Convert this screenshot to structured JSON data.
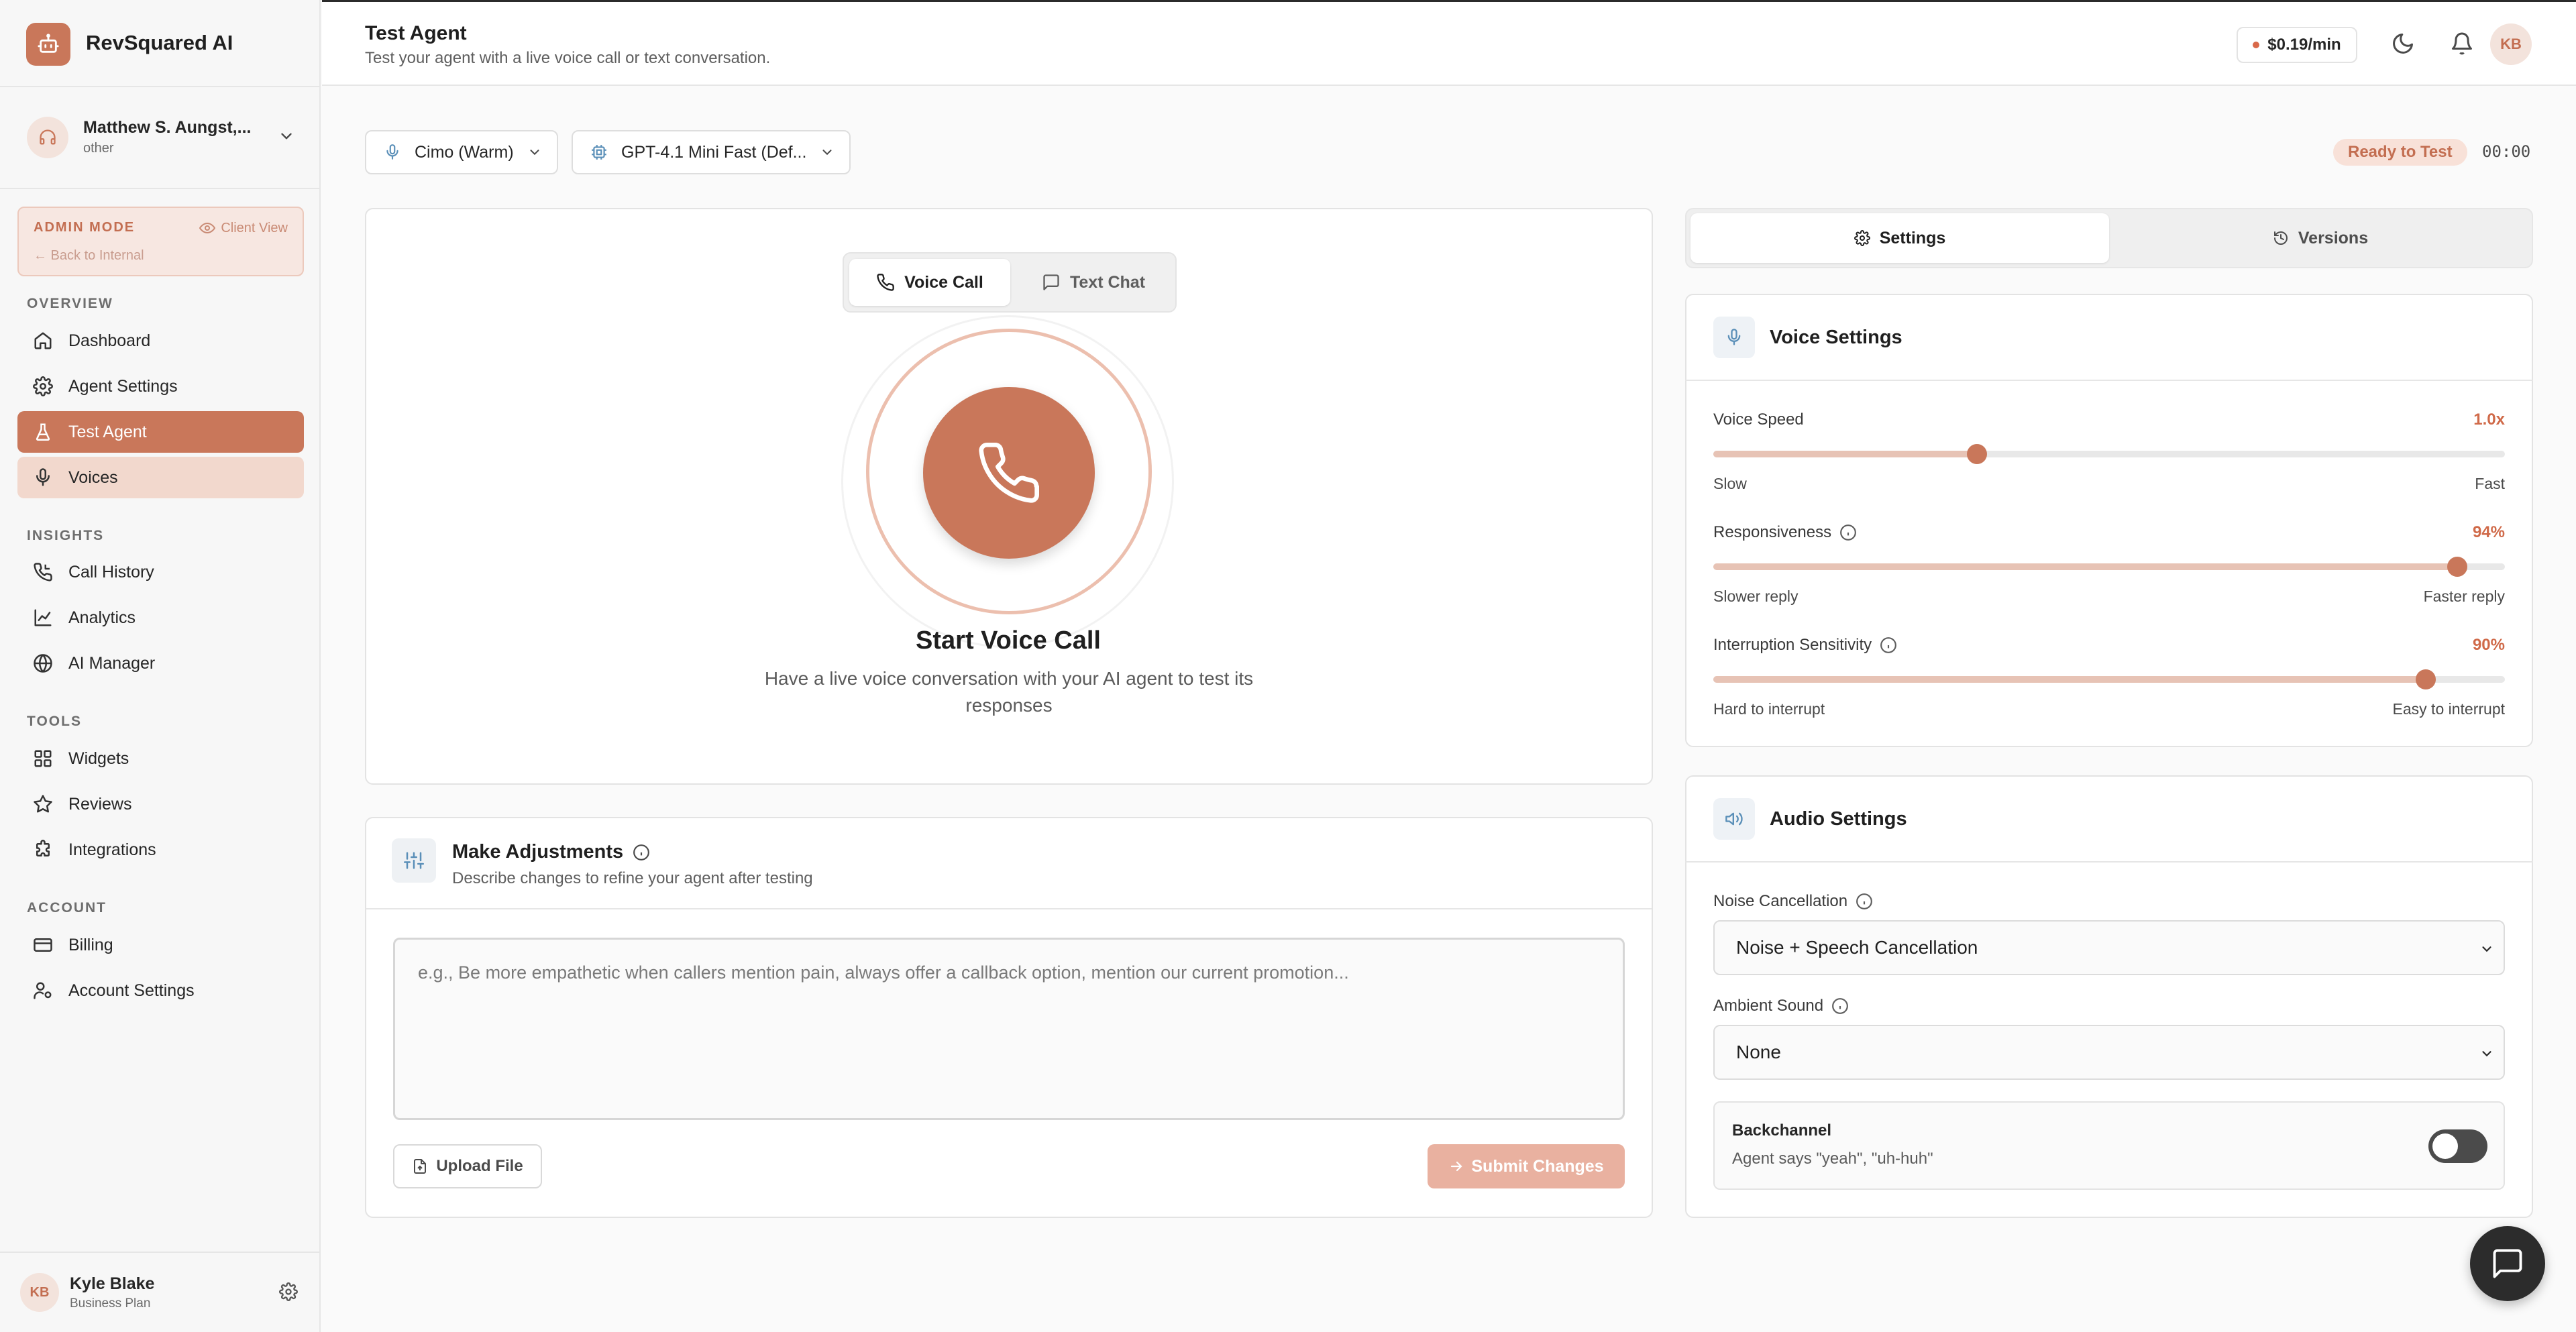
{
  "brand": {
    "name": "RevSquared AI",
    "icon": "robot-icon"
  },
  "account": {
    "name": "Matthew S. Aungst,...",
    "type": "other"
  },
  "admin": {
    "title": "ADMIN MODE",
    "client_view": "Client View",
    "back": "← Back to Internal"
  },
  "nav": {
    "overview_label": "OVERVIEW",
    "insights_label": "INSIGHTS",
    "tools_label": "TOOLS",
    "account_label": "ACCOUNT",
    "items": [
      {
        "label": "Dashboard",
        "icon": "home-icon"
      },
      {
        "label": "Agent Settings",
        "icon": "gear-icon"
      },
      {
        "label": "Test Agent",
        "icon": "flask-icon",
        "state": "active"
      },
      {
        "label": "Voices",
        "icon": "microphone-icon",
        "state": "hover"
      },
      {
        "label": "Call History",
        "icon": "phone-history-icon"
      },
      {
        "label": "Analytics",
        "icon": "line-chart-icon"
      },
      {
        "label": "AI Manager",
        "icon": "globe-icon"
      },
      {
        "label": "Widgets",
        "icon": "grid-icon"
      },
      {
        "label": "Reviews",
        "icon": "star-icon"
      },
      {
        "label": "Integrations",
        "icon": "puzzle-icon"
      },
      {
        "label": "Billing",
        "icon": "credit-card-icon"
      },
      {
        "label": "Account Settings",
        "icon": "user-cog-icon"
      }
    ]
  },
  "user": {
    "initials": "KB",
    "name": "Kyle Blake",
    "plan": "Business Plan"
  },
  "header": {
    "title": "Test Agent",
    "subtitle": "Test your agent with a live voice call or text conversation.",
    "price": "$0.19/min",
    "avatar_initials": "KB"
  },
  "controls": {
    "voice_select": "Cimo (Warm)",
    "model_select": "GPT-4.1 Mini Fast (Def...",
    "status": "Ready to Test",
    "timer": "00:00"
  },
  "test_panel": {
    "mode_voice": "Voice Call",
    "mode_text": "Text Chat",
    "title": "Start Voice Call",
    "description": "Have a live voice conversation with your AI agent to test its responses"
  },
  "adjustments": {
    "title": "Make Adjustments",
    "subtitle": "Describe changes to refine your agent after testing",
    "placeholder": "e.g., Be more empathetic when callers mention pain, always offer a callback option, mention our current promotion...",
    "upload_label": "Upload File",
    "submit_label": "Submit Changes"
  },
  "right_tabs": {
    "settings": "Settings",
    "versions": "Versions"
  },
  "voice_settings": {
    "title": "Voice Settings",
    "speed": {
      "label": "Voice Speed",
      "value": "1.0x",
      "level": 0.333,
      "min": "Slow",
      "max": "Fast"
    },
    "responsiveness": {
      "label": "Responsiveness",
      "value": "94%",
      "level": 0.94,
      "min": "Slower reply",
      "max": "Faster reply"
    },
    "interruption": {
      "label": "Interruption Sensitivity",
      "value": "90%",
      "level": 0.9,
      "min": "Hard to interrupt",
      "max": "Easy to interrupt"
    }
  },
  "audio_settings": {
    "title": "Audio Settings",
    "noise_label": "Noise Cancellation",
    "noise_value": "Noise + Speech Cancellation",
    "ambient_label": "Ambient Sound",
    "ambient_value": "None",
    "backchannel_title": "Backchannel",
    "backchannel_desc": "Agent says \"yeah\", \"uh-huh\"",
    "backchannel_on": false
  },
  "colors": {
    "accent": "#c9775a",
    "accent_soft": "#f2d8cd",
    "value_text": "#d06a49"
  }
}
